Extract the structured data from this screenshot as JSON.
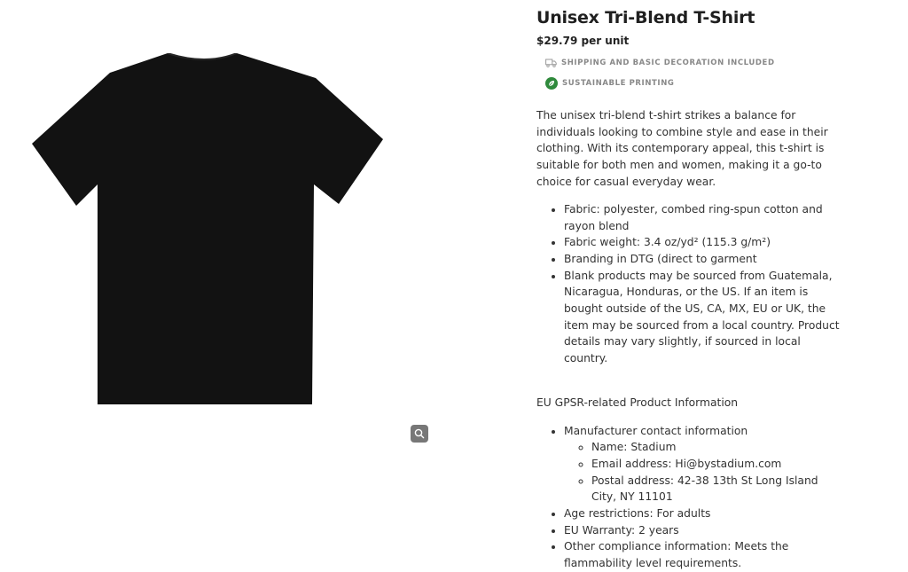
{
  "product": {
    "title": "Unisex Tri-Blend T-Shirt",
    "price": "$29.79 per unit",
    "features": [
      {
        "icon": "truck-icon",
        "label": "SHIPPING AND BASIC DECORATION INCLUDED"
      },
      {
        "icon": "leaf-icon",
        "label": "SUSTAINABLE PRINTING"
      }
    ],
    "description": "The unisex tri-blend t-shirt strikes a balance for individuals looking to combine style and ease in their clothing. With its contemporary appeal, this t-shirt is suitable for both men and women, making it a go-to choice for casual everyday wear.",
    "bullets": [
      "Fabric: polyester, combed ring-spun cotton and rayon blend",
      "Fabric weight: 3.4 oz/yd² (115.3 g/m²)",
      "Branding in DTG (direct to garment",
      "Blank products may be sourced from Guatemala, Nicaragua, Honduras, or the US. If an item is bought outside of the US, CA, MX, EU or UK, the item may be sourced from a local country. Product details may vary slightly, if sourced in local country."
    ],
    "gpsr_heading": "EU GPSR-related Product Information",
    "gpsr": {
      "manufacturer_label": "Manufacturer contact information",
      "manufacturer": [
        "Name: Stadium",
        "Email address: Hi@bystadium.com",
        "Postal address: 42-38 13th St Long Island City, NY 11101"
      ],
      "age": "Age restrictions: For adults",
      "warranty": "EU Warranty: 2 years",
      "compliance": "Other compliance information: Meets the flammability level requirements."
    }
  },
  "image": {
    "shirt_color": "#121212",
    "zoom_icon": "magnifier-icon"
  },
  "colors": {
    "leaf_badge": "#2f8a3c",
    "feature_text": "#888888"
  }
}
